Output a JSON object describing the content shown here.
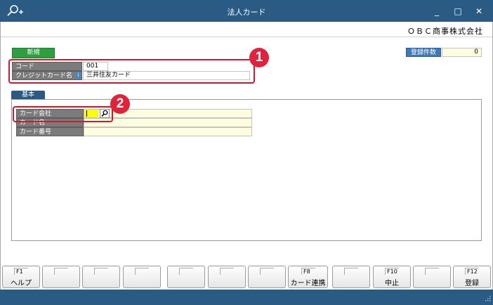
{
  "window": {
    "title": "法人カード",
    "minimize": "_",
    "maximize": "□",
    "close": "✕"
  },
  "company": "ＯＢＣ商事株式会社",
  "mode_badge": "新規",
  "record_count": {
    "label": "登録件数",
    "value": "0"
  },
  "header_fields": {
    "code_label": "コード",
    "code_value": "001",
    "card_name_label": "クレジットカード名",
    "card_name_value": "三井住友カード"
  },
  "callouts": [
    "1",
    "2"
  ],
  "tab": "基本",
  "basic_fields": [
    {
      "label": "カード会社",
      "value": ""
    },
    {
      "label": "カード名",
      "value": ""
    },
    {
      "label": "カード番号",
      "value": ""
    }
  ],
  "function_keys": [
    {
      "key": "F1",
      "label": "ヘルプ"
    },
    {
      "key": "",
      "label": ""
    },
    {
      "key": "",
      "label": ""
    },
    {
      "key": "",
      "label": ""
    },
    {
      "key": "",
      "label": ""
    },
    {
      "key": "",
      "label": ""
    },
    {
      "key": "",
      "label": ""
    },
    {
      "key": "F8",
      "label": "カード連携"
    },
    {
      "key": "",
      "label": ""
    },
    {
      "key": "F10",
      "label": "中止"
    },
    {
      "key": "",
      "label": ""
    },
    {
      "key": "F12",
      "label": "登録"
    }
  ],
  "colors": {
    "titlebar": "#2a5b85",
    "callout": "#e0233a",
    "new_badge": "#2e9e3e"
  }
}
